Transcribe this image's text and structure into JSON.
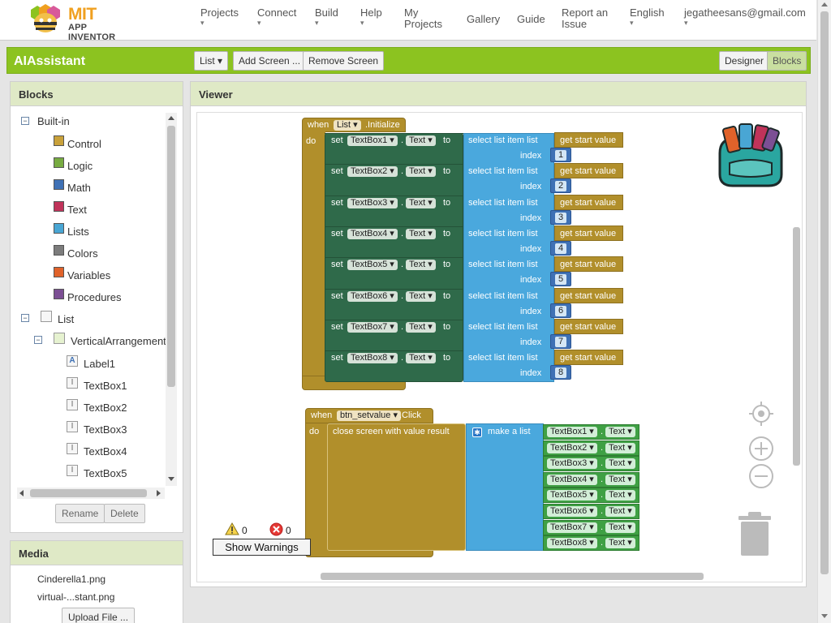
{
  "header": {
    "logo_mit": "MIT",
    "logo_sub": "APP INVENTOR",
    "nav": [
      {
        "label": "Projects",
        "caret": "▾"
      },
      {
        "label": "Connect",
        "caret": "▾"
      },
      {
        "label": "Build",
        "caret": "▾"
      },
      {
        "label": "Help",
        "caret": "▾"
      },
      {
        "label": "My Projects"
      },
      {
        "label": "Gallery"
      },
      {
        "label": "Guide"
      },
      {
        "label": "Report an Issue"
      },
      {
        "label": "English",
        "caret": "▾"
      },
      {
        "label": "jegatheesans@gmail.com",
        "caret": "▾"
      }
    ]
  },
  "projectbar": {
    "name": "AIAssistant",
    "screen_select": "List ▾",
    "add_screen": "Add Screen ...",
    "remove_screen": "Remove Screen",
    "designer": "Designer",
    "blocks": "Blocks"
  },
  "blocks_panel": {
    "title": "Blocks",
    "builtin_label": "Built-in",
    "builtin": [
      {
        "label": "Control",
        "color": "#c9a13a"
      },
      {
        "label": "Logic",
        "color": "#77ab41"
      },
      {
        "label": "Math",
        "color": "#3f71b5"
      },
      {
        "label": "Text",
        "color": "#c0335a"
      },
      {
        "label": "Lists",
        "color": "#49a6d4"
      },
      {
        "label": "Colors",
        "color": "#7c7c7c"
      },
      {
        "label": "Variables",
        "color": "#e0622a"
      },
      {
        "label": "Procedures",
        "color": "#7c4f94"
      }
    ],
    "screen": "List",
    "arrangement": "VerticalArrangement1",
    "components": [
      "Label1",
      "TextBox1",
      "TextBox2",
      "TextBox3",
      "TextBox4",
      "TextBox5"
    ],
    "rename": "Rename",
    "delete": "Delete"
  },
  "media_panel": {
    "title": "Media",
    "files": [
      "Cinderella1.png",
      "virtual-...stant.png"
    ],
    "upload": "Upload File ..."
  },
  "viewer": {
    "title": "Viewer",
    "warnings_count": "0",
    "errors_count": "0",
    "show_warnings": "Show Warnings",
    "init_block": {
      "when": "when",
      "component": "List",
      "event": ".Initialize",
      "do": "do",
      "rows": [
        {
          "set": "set",
          "textbox": "TextBox1",
          "prop": "Text",
          "to": "to",
          "select": "select list item  list",
          "index_label": "index",
          "getter": "get start value",
          "index": "1"
        },
        {
          "set": "set",
          "textbox": "TextBox2",
          "prop": "Text",
          "to": "to",
          "select": "select list item  list",
          "index_label": "index",
          "getter": "get start value",
          "index": "2"
        },
        {
          "set": "set",
          "textbox": "TextBox3",
          "prop": "Text",
          "to": "to",
          "select": "select list item  list",
          "index_label": "index",
          "getter": "get start value",
          "index": "3"
        },
        {
          "set": "set",
          "textbox": "TextBox4",
          "prop": "Text",
          "to": "to",
          "select": "select list item  list",
          "index_label": "index",
          "getter": "get start value",
          "index": "4"
        },
        {
          "set": "set",
          "textbox": "TextBox5",
          "prop": "Text",
          "to": "to",
          "select": "select list item  list",
          "index_label": "index",
          "getter": "get start value",
          "index": "5"
        },
        {
          "set": "set",
          "textbox": "TextBox6",
          "prop": "Text",
          "to": "to",
          "select": "select list item  list",
          "index_label": "index",
          "getter": "get start value",
          "index": "6"
        },
        {
          "set": "set",
          "textbox": "TextBox7",
          "prop": "Text",
          "to": "to",
          "select": "select list item  list",
          "index_label": "index",
          "getter": "get start value",
          "index": "7"
        },
        {
          "set": "set",
          "textbox": "TextBox8",
          "prop": "Text",
          "to": "to",
          "select": "select list item  list",
          "index_label": "index",
          "getter": "get start value",
          "index": "8"
        }
      ]
    },
    "click_block": {
      "when": "when",
      "component": "btn_setvalue",
      "event": ".Click",
      "do": "do",
      "close": "close screen with value  result",
      "make_list": "make a list",
      "items": [
        {
          "textbox": "TextBox1",
          "prop": "Text"
        },
        {
          "textbox": "TextBox2",
          "prop": "Text"
        },
        {
          "textbox": "TextBox3",
          "prop": "Text"
        },
        {
          "textbox": "TextBox4",
          "prop": "Text"
        },
        {
          "textbox": "TextBox5",
          "prop": "Text"
        },
        {
          "textbox": "TextBox6",
          "prop": "Text"
        },
        {
          "textbox": "TextBox7",
          "prop": "Text"
        },
        {
          "textbox": "TextBox8",
          "prop": "Text"
        }
      ]
    }
  }
}
